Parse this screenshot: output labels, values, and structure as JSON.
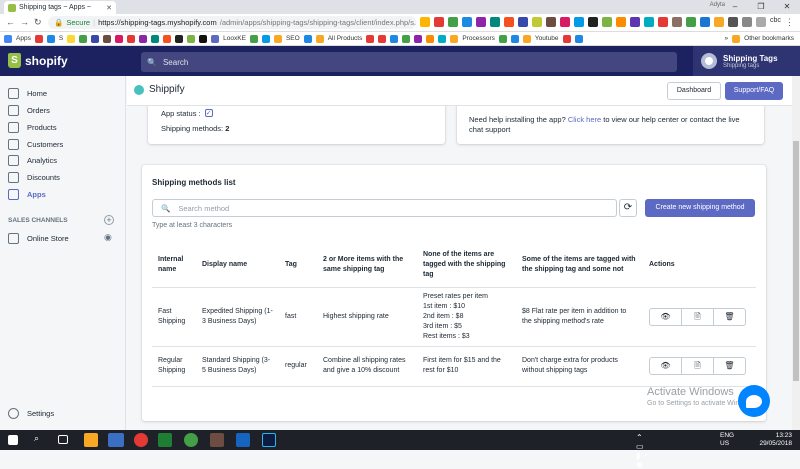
{
  "browser": {
    "tab_title": "Shipping tags ~ Apps ~",
    "user_label": "Adyta",
    "secure_label": "Secure",
    "url_domain": "https://shipping-tags.myshopify.com",
    "url_path": "/admin/apps/shipping-tags/shipping-tags/client/index.php/s...",
    "bookmarks": [
      "Apps",
      "S",
      "LooxKE",
      "SEO",
      "All Products",
      "Processors",
      "Youtube"
    ],
    "other_bookmarks": "Other bookmarks",
    "extra_tab": "cbc"
  },
  "topbar": {
    "brand": "shopify",
    "search_placeholder": "Search",
    "store_name": "Shipping Tags",
    "store_sub": "Shipping tags"
  },
  "sidebar": {
    "items": [
      {
        "label": "Home",
        "icon": "home-icon"
      },
      {
        "label": "Orders",
        "icon": "orders-icon"
      },
      {
        "label": "Products",
        "icon": "tag-icon"
      },
      {
        "label": "Customers",
        "icon": "user-icon"
      },
      {
        "label": "Analytics",
        "icon": "bar-chart-icon"
      },
      {
        "label": "Discounts",
        "icon": "discount-icon"
      },
      {
        "label": "Apps",
        "icon": "apps-icon"
      }
    ],
    "sales_channels_header": "SALES CHANNELS",
    "online_store": "Online Store",
    "settings": "Settings"
  },
  "app": {
    "title": "Shippify",
    "dashboard_btn": "Dashboard",
    "support_btn": "Support/FAQ"
  },
  "status_card": {
    "app_status_label": "App status :",
    "shipping_methods_label": "Shipping methods:",
    "shipping_methods_count": "2"
  },
  "help_card": {
    "text_before": "Need help installing the app?",
    "link": "Click here",
    "text_after": "to view our help center or contact the live chat support"
  },
  "methods": {
    "title": "Shipping methods list",
    "search_placeholder": "Search method",
    "create_btn": "Create new shipping method",
    "hint": "Type at least 3 characters",
    "columns": [
      "Internal name",
      "Display name",
      "Tag",
      "2 or More items with the same shipping tag",
      "None of the items are tagged with the shipping tag",
      "Some of the items are tagged with the shipping tag and some not",
      "Actions"
    ],
    "rows": [
      {
        "internal": "Fast Shipping",
        "display": "Expedited Shipping (1-3 Business Days)",
        "tag": "fast",
        "two_or_more": "Highest shipping rate",
        "none_tagged": [
          "Preset rates per item",
          "1st item : $10",
          "2nd item : $8",
          "3rd item : $5",
          "Rest items : $3"
        ],
        "some_tagged": "$8 Flat rate per item in addition to the shipping method's rate"
      },
      {
        "internal": "Regular Shipping",
        "display": "Standard Shipping (3-5 Business Days)",
        "tag": "regular",
        "two_or_more": "Combine all shipping rates and give a 10% discount",
        "none_tagged": [
          "First item for $15 and the rest for $10"
        ],
        "some_tagged": "Don't charge extra for products without shipping tags"
      }
    ]
  },
  "watermark": {
    "line1": "Activate Windows",
    "line2": "Go to Settings to activate Windows."
  },
  "taskbar": {
    "lang": "ENG",
    "region": "US",
    "time": "13:23",
    "date": "29/05/2018"
  }
}
